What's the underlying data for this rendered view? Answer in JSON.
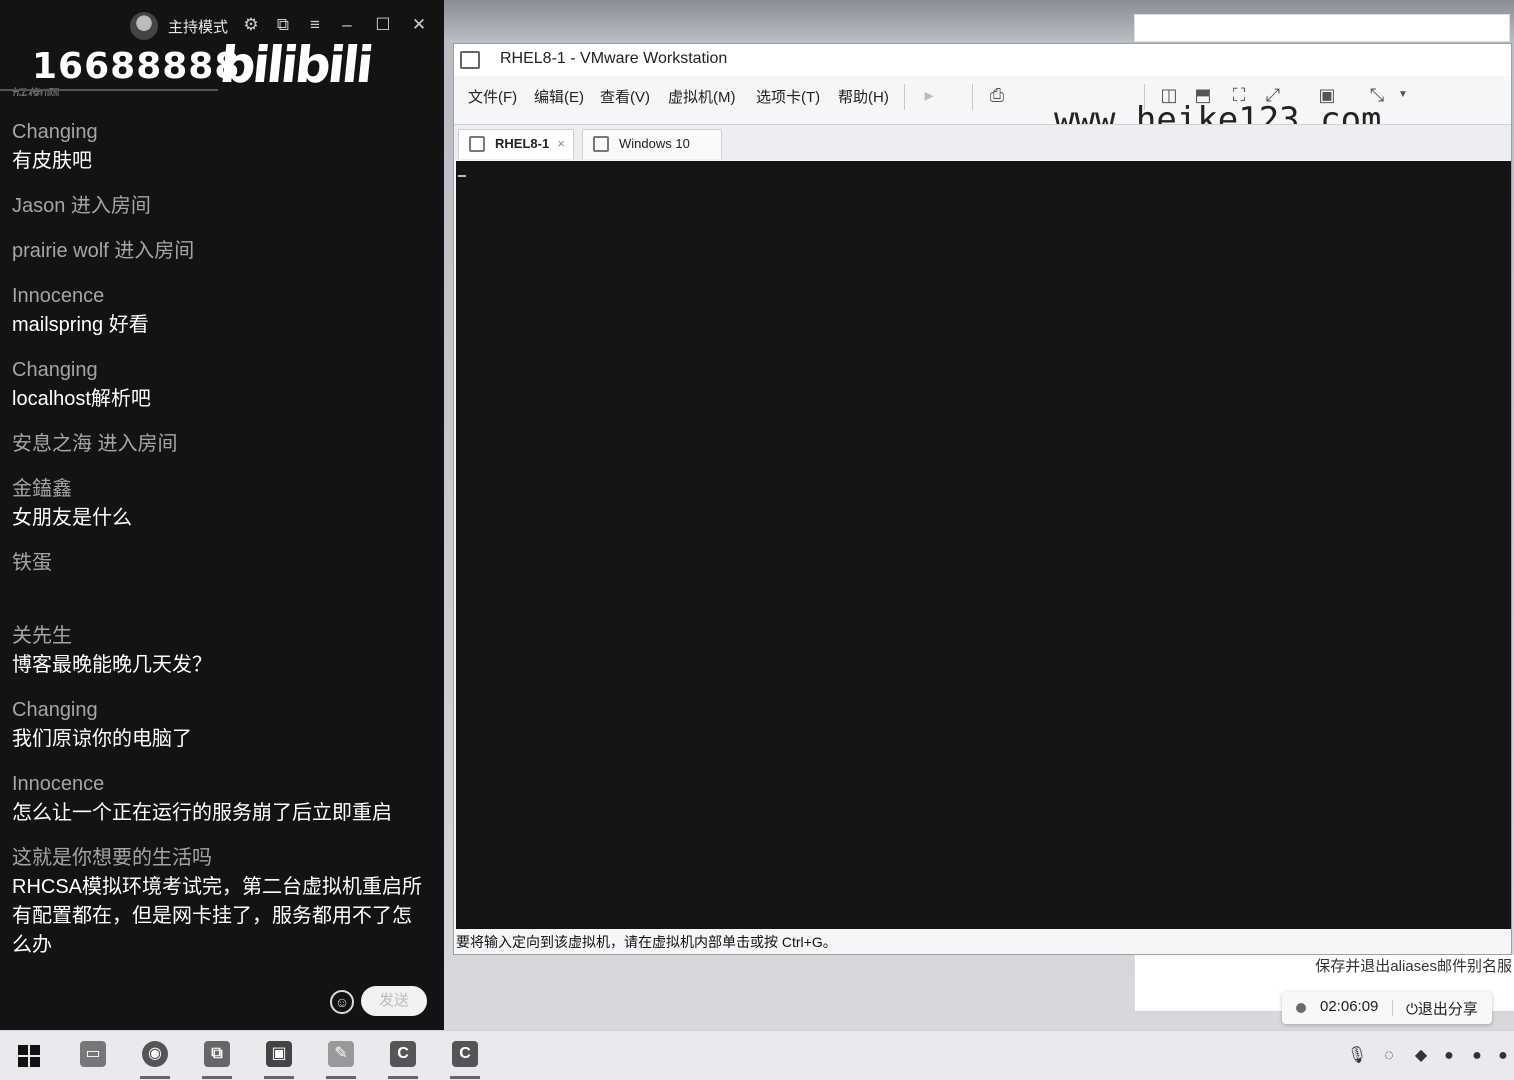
{
  "chat": {
    "host_mode_label": "主持模式",
    "room_number": "16688888",
    "brand": "bilibili",
    "partial_top_text": "好像啊",
    "messages": [
      {
        "user": "Changing",
        "text": "有皮肤吧"
      },
      {
        "user": "Jason 进入房间",
        "text": ""
      },
      {
        "user": "prairie wolf 进入房间",
        "text": ""
      },
      {
        "user": "Innocence",
        "text": "mailspring 好看"
      },
      {
        "user": "Changing",
        "text": "localhost解析吧"
      },
      {
        "user": "安息之海 进入房间",
        "text": ""
      },
      {
        "user": "金鎑鑫",
        "text": "女朋友是什么"
      },
      {
        "user": "铁蛋",
        "text": ""
      },
      {
        "user": "关先生",
        "text": "博客最晚能晚几天发？"
      },
      {
        "user": "Changing",
        "text": "我们原谅你的电脑了"
      },
      {
        "user": "Innocence",
        "text": "怎么让一个正在运行的服务崩了后立即重启"
      },
      {
        "user": "这就是你想要的生活吗",
        "text": "RHCSA模拟环境考试完，第二台虚拟机重启所有配置都在，但是网卡挂了，服务都用不了怎么办"
      }
    ],
    "send_label": "发送",
    "icons": [
      "settings-icon",
      "popout-icon",
      "menu-icon",
      "minimize-icon",
      "maximize-icon",
      "close-icon",
      "emoji-icon"
    ]
  },
  "vmware": {
    "title": "RHEL8-1 - VMware Workstation",
    "menu": [
      "文件(F)",
      "编辑(E)",
      "查看(V)",
      "虚拟机(M)",
      "选项卡(T)",
      "帮助(H)"
    ],
    "tabs": [
      {
        "label": "RHEL8-1",
        "active": true
      },
      {
        "label": "Windows 10",
        "active": false
      }
    ],
    "watermark": "www.heike123.com",
    "status_text": "要将输入定向到该虚拟机，请在虚拟机内部单击或按 Ctrl+G。",
    "console_color": "#141414"
  },
  "notification": {
    "text": "保存并退出aliases邮件别名服"
  },
  "share_bar": {
    "timer": "02:06:09",
    "exit_label": "退出分享"
  },
  "taskbar": {
    "apps": [
      "file-explorer-icon",
      "chrome-icon",
      "vmware-icon",
      "media-icon",
      "paint-icon",
      "app-c-icon",
      "app-c2-icon"
    ],
    "tray": [
      "mic-icon",
      "network-icon",
      "app-tray-icon",
      "qq-icon",
      "qq-icon-2",
      "qq-icon-3"
    ]
  }
}
